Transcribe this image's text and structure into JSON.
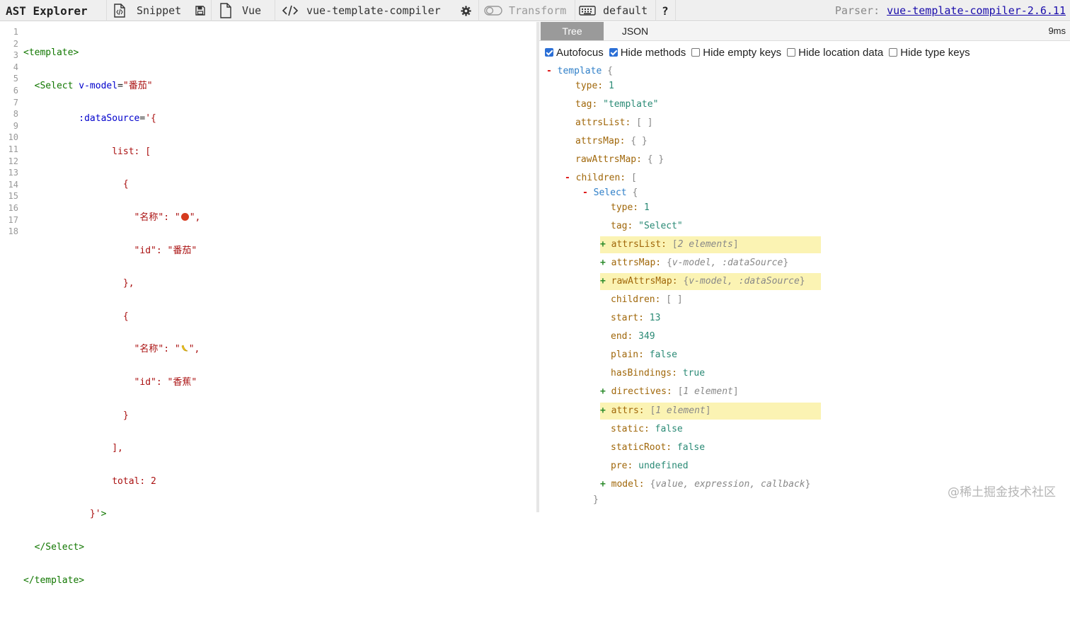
{
  "toolbar": {
    "app_title": "AST Explorer",
    "snippet_label": "Snippet",
    "language_label": "Vue",
    "parser_name": "vue-template-compiler",
    "transform_label": "Transform",
    "keymap_label": "default",
    "help_label": "?",
    "parser_prefix": "Parser:",
    "parser_version_link": "vue-template-compiler-2.6.11"
  },
  "editor": {
    "line_numbers": [
      "1",
      "2",
      "3",
      "4",
      "5",
      "6",
      "7",
      "8",
      "9",
      "10",
      "11",
      "12",
      "13",
      "14",
      "15",
      "16",
      "17",
      "18"
    ],
    "code": {
      "l1_tag": "<template>",
      "l2_tag_open": "<Select",
      "l2_attr": "v-model",
      "l2_eq": "=",
      "l2_val": "\"番茄\"",
      "l3_attr": ":dataSource",
      "l3_eq": "=",
      "l3_val": "'{",
      "l4": "list: [",
      "l5": "{",
      "l6_key": "\"名称\": \"",
      "l6_end": "\",",
      "l7": "\"id\": \"番茄\"",
      "l8": "},",
      "l9": "{",
      "l10_key": "\"名称\": \"",
      "l10_end": "\",",
      "l11": "\"id\": \"香蕉\"",
      "l12": "}",
      "l13": "],",
      "l14": "total: 2",
      "l15_val": "}'",
      "l15_tag": ">",
      "l16": "</Select>",
      "l17": "</template>"
    }
  },
  "output": {
    "tab_tree": "Tree",
    "tab_json": "JSON",
    "timing": "9ms",
    "options": {
      "autofocus": "Autofocus",
      "hide_methods": "Hide methods",
      "hide_empty_keys": "Hide empty keys",
      "hide_location_data": "Hide location data",
      "hide_type_keys": "Hide type keys"
    },
    "tree": {
      "root_toggle": "-",
      "root_name": "template",
      "root_brace": "{",
      "root_type_key": "type:",
      "root_type_val": "1",
      "root_tag_key": "tag:",
      "root_tag_val": "\"template\"",
      "root_attrsList_key": "attrsList:",
      "root_attrsList_val": "[ ]",
      "root_attrsMap_key": "attrsMap:",
      "root_attrsMap_val": "{ }",
      "root_rawAttrsMap_key": "rawAttrsMap:",
      "root_rawAttrsMap_val": "{ }",
      "children_toggle": "-",
      "children_key": "children:",
      "children_bracket": "[",
      "select_toggle": "-",
      "select_name": "Select",
      "select_brace": "{",
      "select_type_key": "type:",
      "select_type_val": "1",
      "select_tag_key": "tag:",
      "select_tag_val": "\"Select\"",
      "attrsList_toggle": "+",
      "attrsList_key": "attrsList:",
      "attrsList_sum": "2 elements",
      "attrsMap_toggle": "+",
      "attrsMap_key": "attrsMap:",
      "attrsMap_sum": "v-model, :dataSource",
      "rawAttrsMap_toggle": "+",
      "rawAttrsMap_key": "rawAttrsMap:",
      "rawAttrsMap_sum": "v-model, :dataSource",
      "children2_key": "children:",
      "children2_val": "[ ]",
      "start_key": "start:",
      "start_val": "13",
      "end_key": "end:",
      "end_val": "349",
      "plain_key": "plain:",
      "plain_val": "false",
      "hasBindings_key": "hasBindings:",
      "hasBindings_val": "true",
      "directives_toggle": "+",
      "directives_key": "directives:",
      "directives_sum": "1 element",
      "attrs_toggle": "+",
      "attrs_key": "attrs:",
      "attrs_sum": "1 element",
      "static_key": "static:",
      "static_val": "false",
      "staticRoot_key": "staticRoot:",
      "staticRoot_val": "false",
      "pre_key": "pre:",
      "pre_val": "undefined",
      "model_toggle": "+",
      "model_key": "model:",
      "model_sum": "value, expression, callback",
      "close_brace": "}"
    }
  },
  "watermark": "@稀土掘金技术社区",
  "colors": {
    "toolbar_bg": "#efefef",
    "highlight": "#fbf3b3",
    "tree_key": "#a0670a",
    "tree_value": "#2a8a75",
    "node_name": "#2f7fc8"
  }
}
